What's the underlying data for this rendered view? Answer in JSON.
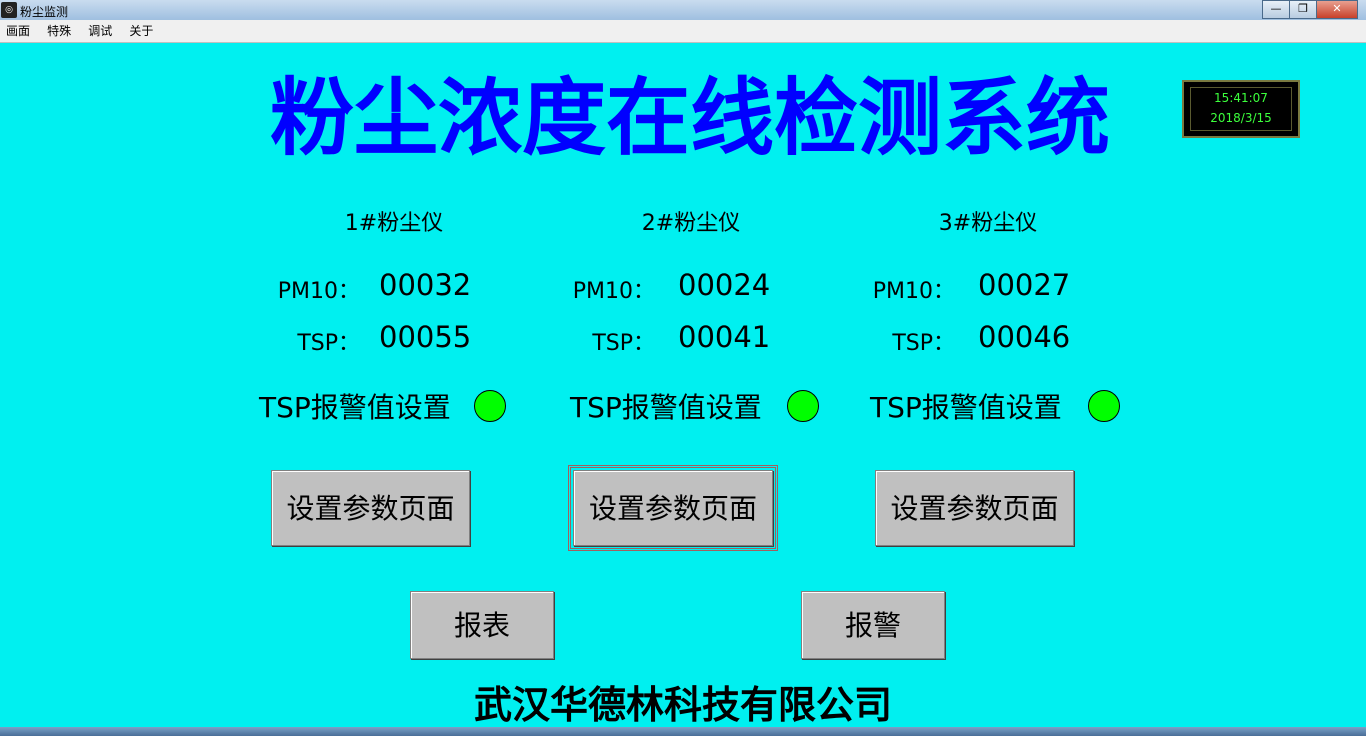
{
  "window": {
    "title": "粉尘监测",
    "icon": "app-icon",
    "controls": {
      "minimize": "—",
      "maximize": "❐",
      "close": "✕"
    }
  },
  "menu": [
    "画面",
    "特殊",
    "调试",
    "关于"
  ],
  "header": {
    "title": "粉尘浓度在线检测系统"
  },
  "clock": {
    "time": "15:41:07",
    "date": "2018/3/15"
  },
  "devices": [
    {
      "name": "1#粉尘仪",
      "pm10_label": "PM10：",
      "pm10": "00032",
      "tsp_label": "TSP：",
      "tsp": "00055",
      "alarm_label": "TSP报警值设置",
      "button": "设置参数页面"
    },
    {
      "name": "2#粉尘仪",
      "pm10_label": "PM10：",
      "pm10": "00024",
      "tsp_label": "TSP：",
      "tsp": "00041",
      "alarm_label": "TSP报警值设置",
      "button": "设置参数页面"
    },
    {
      "name": "3#粉尘仪",
      "pm10_label": "PM10：",
      "pm10": "00027",
      "tsp_label": "TSP：",
      "tsp": "00046",
      "alarm_label": "TSP报警值设置",
      "button": "设置参数页面"
    }
  ],
  "buttons": {
    "report": "报表",
    "alarm": "报警"
  },
  "footer": {
    "company": "武汉华德林科技有限公司"
  },
  "colors": {
    "background": "#00f0f0",
    "title": "#0000ff",
    "led": "#00ff00",
    "clock_text": "#3cff3c"
  }
}
